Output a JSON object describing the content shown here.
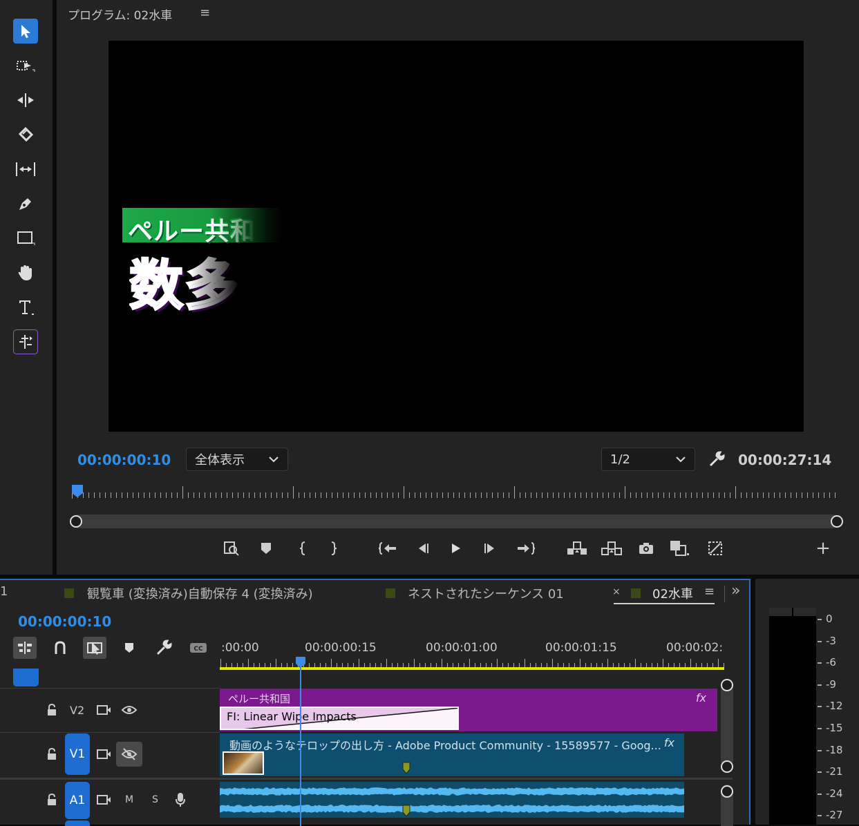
{
  "colors": {
    "accent_blue": "#2e8ee8",
    "panel_bg": "#232323",
    "v2_clip": "#7a1a8c",
    "v1_clip": "#0e4e6e",
    "work_area": "#e6e600"
  },
  "toolbar": {
    "tools": [
      "selection-tool",
      "track-select-tool",
      "ripple-edit-tool",
      "razor-tool",
      "slip-tool",
      "pen-tool",
      "rectangle-tool",
      "hand-tool",
      "type-tool",
      "remix-tool"
    ]
  },
  "monitor": {
    "title": "プログラム: 02水車",
    "menu_glyph": "≡",
    "current_timecode": "00:00:00:10",
    "zoom_select": "全体表示",
    "resolution_select": "1/2",
    "duration_timecode": "00:00:27:14",
    "overlay_green_text": "ペルー共和",
    "overlay_purple_text": "数多",
    "add_glyph": "+"
  },
  "timeline": {
    "tab_partial": "1",
    "tabs": [
      "観覧車 (変換済み)自動保存 4 (変換済み)",
      "ネストされたシーケンス 01",
      "02水車"
    ],
    "close_glyph": "×",
    "menu_glyph": "≡",
    "overflow_glyph": "»",
    "timecode": "00:00:00:10",
    "ruler_labels": [
      ":00:00",
      "00:00:00:15",
      "00:00:01:00",
      "00:00:01:15",
      "00:00:02:"
    ],
    "tracks": {
      "v2": {
        "name": "V2"
      },
      "v1": {
        "name": "V1"
      },
      "a1": {
        "name": "A1",
        "mute": "M",
        "solo": "S"
      }
    },
    "clips": {
      "v2_label": "ペルー共和国",
      "v2_fx": "fx",
      "transition_label": "FI: Linear Wipe Impacts",
      "v1_label": "動画のようなテロップの出し方 - Adobe Product Community - 15589577 - Goog...",
      "v1_fx": "fx"
    }
  },
  "meter": {
    "labels": [
      "0",
      "-3",
      "-6",
      "-9",
      "-12",
      "-15",
      "-18",
      "-21",
      "-24",
      "-27"
    ]
  }
}
